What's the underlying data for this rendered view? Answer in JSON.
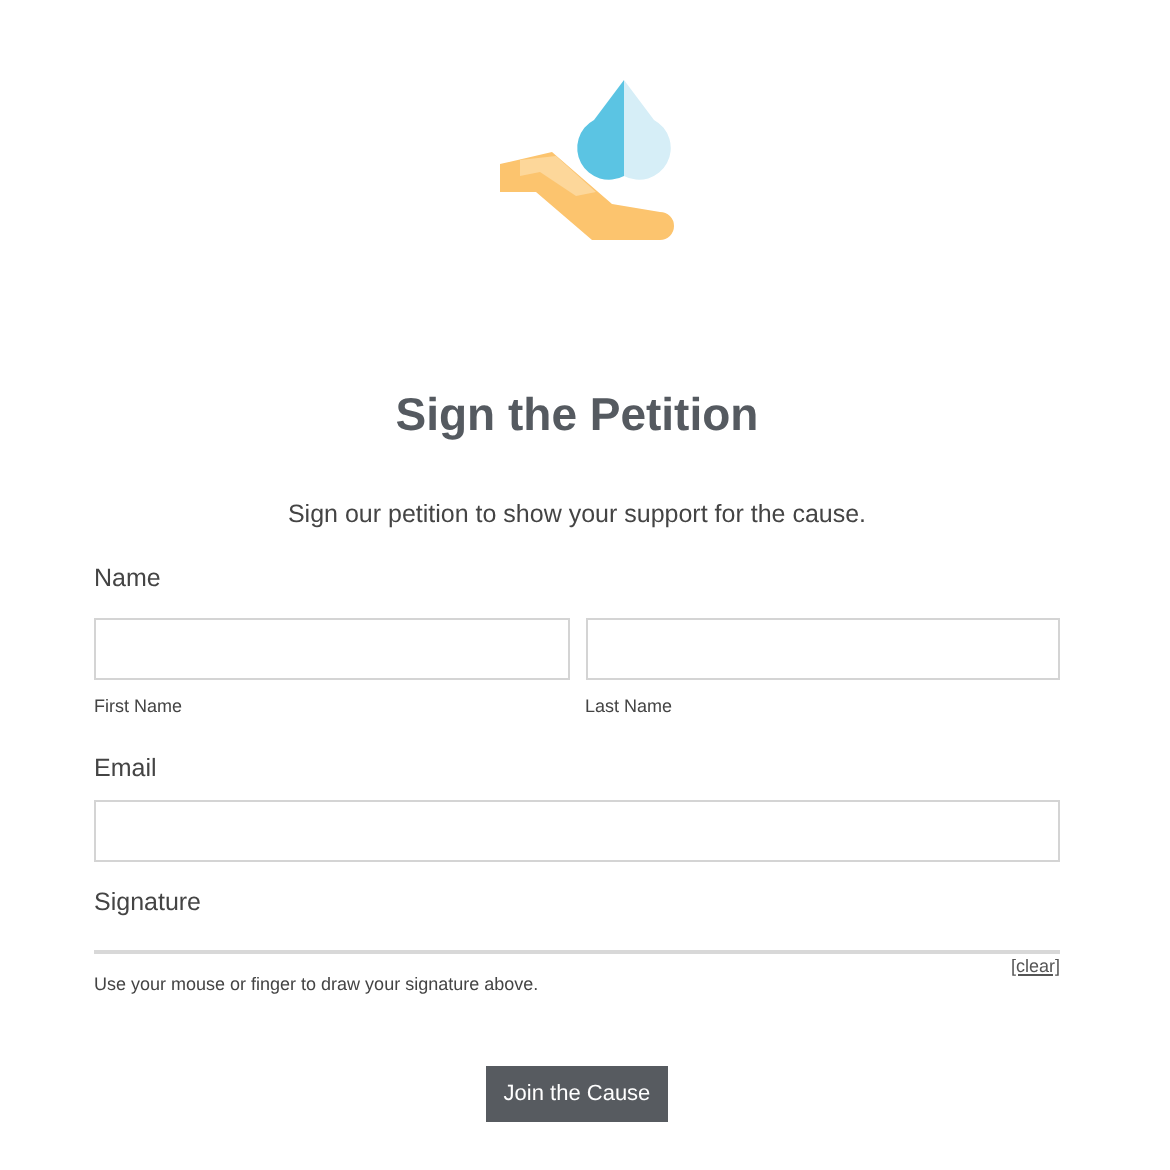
{
  "title": "Sign the Petition",
  "subtitle": "Sign our petition to show your support for the cause.",
  "name": {
    "label": "Name",
    "parts": [
      {
        "sublabel": "First Name"
      },
      {
        "sublabel": "Last Name"
      }
    ]
  },
  "email": {
    "label": "Email"
  },
  "signature": {
    "label": "Signature",
    "clear": "[clear]",
    "help": "Use your mouse or finger to draw your signature above."
  },
  "submit": "Join the Cause"
}
